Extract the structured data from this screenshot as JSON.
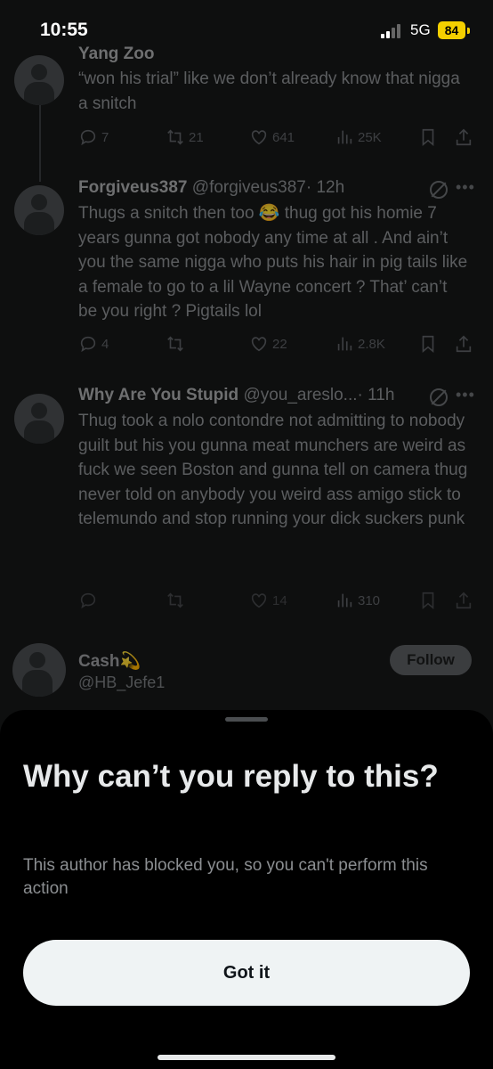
{
  "status_bar": {
    "time": "10:55",
    "network": "5G",
    "battery": "84"
  },
  "tweets": [
    {
      "name": "Yang Zoo",
      "handle": "",
      "time": "",
      "text": "“won his trial” like we don’t already know that nigga a snitch",
      "replies": "7",
      "reposts": "21",
      "likes": "641",
      "views": "25K"
    },
    {
      "name": "Forgiveus387",
      "handle": "@forgiveus387",
      "time": "· 12h",
      "text": "Thugs a snitch then too 😂 thug got his homie 7 years gunna got nobody any time at all . And ain’t you the same nigga who puts his hair in pig tails like a female to go to a lil Wayne concert ? That’ can’t be you right ? Pigtails lol",
      "replies": "4",
      "reposts": "",
      "likes": "22",
      "views": "2.8K"
    },
    {
      "name": "Why Are You Stupid",
      "handle": "@you_areslo...",
      "time": "· 11h",
      "text": "Thug took a nolo contondre not admitting to nobody guilt but his you gunna meat munchers are weird as fuck we seen Boston and gunna tell on camera thug never told on anybody you weird ass amigo stick to telemundo and stop running your dick suckers punk",
      "replies": "",
      "reposts": "",
      "likes": "14",
      "views": "310"
    }
  ],
  "suggested_user": {
    "name": "Cash💫",
    "handle": "@HB_Jefe1",
    "follow_label": "Follow"
  },
  "sheet": {
    "title": "Why can’t you reply to this?",
    "description": "This author has blocked you, so you can't perform this action",
    "button_label": "Got it"
  }
}
